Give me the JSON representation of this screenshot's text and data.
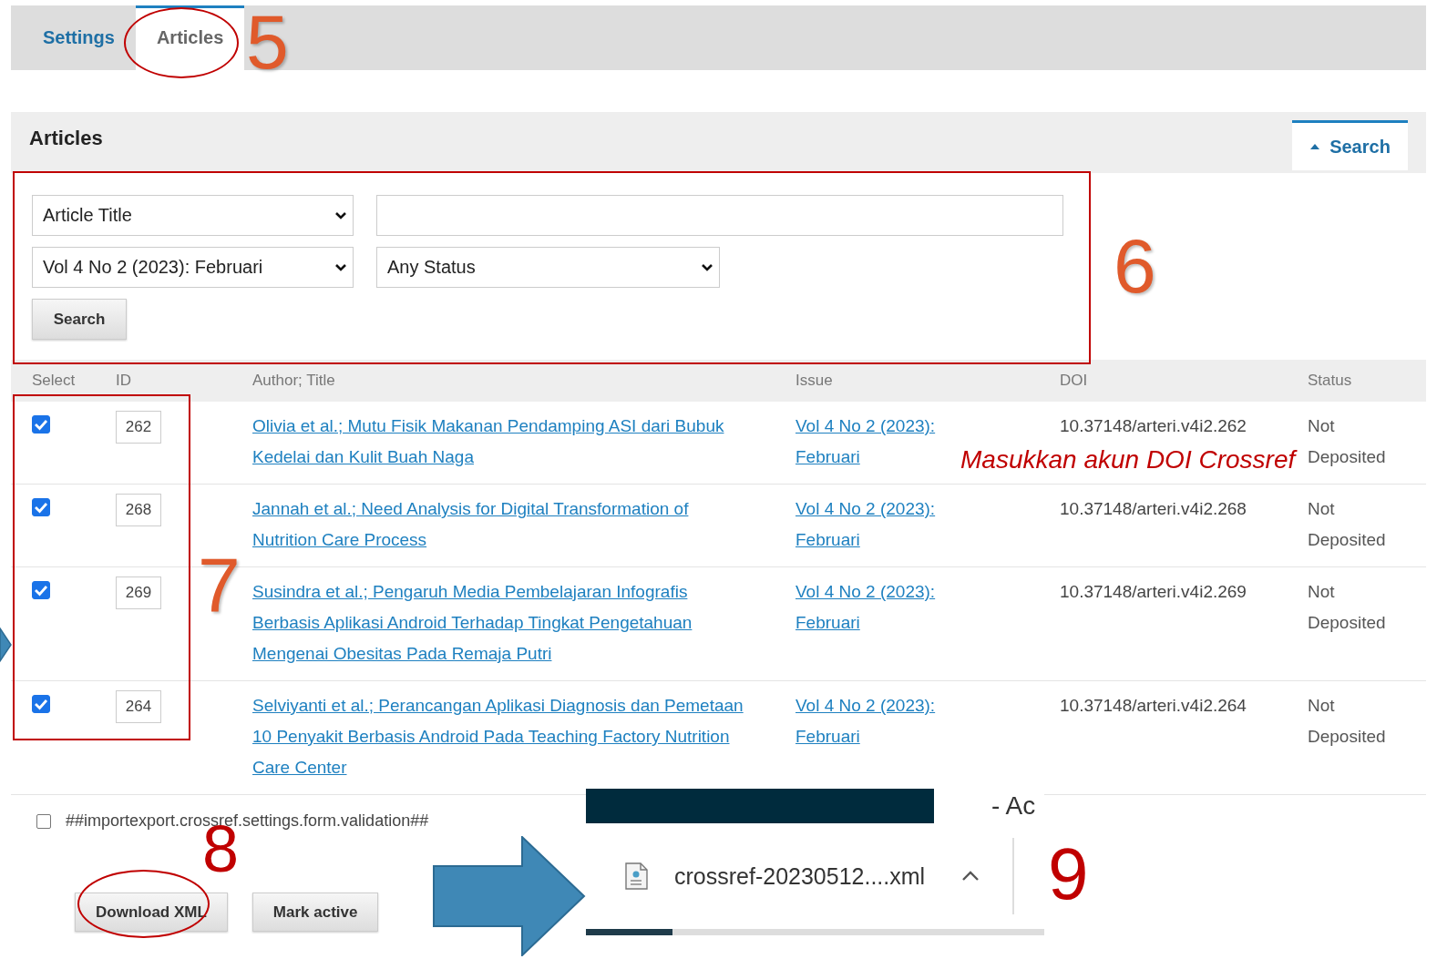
{
  "tabs": [
    {
      "label": "Settings",
      "selected": false
    },
    {
      "label": "Articles",
      "selected": true
    }
  ],
  "panel": {
    "title": "Articles",
    "search_toggle": {
      "label": "Search",
      "expanded": true
    }
  },
  "search_form": {
    "field_select": "Article Title",
    "issue_select": "Vol 4 No 2 (2023): Februari",
    "status_select": "Any Status",
    "button": "Search"
  },
  "table": {
    "columns": [
      "Select",
      "ID",
      "Author; Title",
      "Issue",
      "DOI",
      "Status"
    ],
    "rows": [
      {
        "selected": true,
        "id": "262",
        "title": "Olivia et al.; Mutu Fisik Makanan Pendamping ASI dari Bubuk Kedelai dan Kulit Buah Naga",
        "issue": "Vol 4 No 2 (2023): Februari",
        "doi": "10.37148/arteri.v4i2.262",
        "status": "Not Deposited"
      },
      {
        "selected": true,
        "id": "268",
        "title": "Jannah et al.; Need Analysis for Digital Transformation of Nutrition Care Process",
        "issue": "Vol 4 No 2 (2023): Februari",
        "doi": "10.37148/arteri.v4i2.268",
        "status": "Not Deposited"
      },
      {
        "selected": true,
        "id": "269",
        "title": "Susindra et al.; Pengaruh Media Pembelajaran Infografis Berbasis Aplikasi Android Terhadap Tingkat Pengetahuan Mengenai Obesitas Pada Remaja Putri",
        "issue": "Vol 4 No 2 (2023): Februari",
        "doi": "10.37148/arteri.v4i2.269",
        "status": "Not Deposited"
      },
      {
        "selected": true,
        "id": "264",
        "title": "Selviyanti et al.; Perancangan Aplikasi Diagnosis dan Pemetaan 10 Penyakit Berbasis Android Pada Teaching Factory Nutrition Care Center",
        "issue": "Vol 4 No 2 (2023): Februari",
        "doi": "10.37148/arteri.v4i2.264",
        "status": "Not Deposited"
      }
    ]
  },
  "validation_checkbox": {
    "label": "##importexport.crossref.settings.form.validation##",
    "checked": false
  },
  "buttons": [
    "Download XML",
    "Mark active"
  ],
  "download_bar": {
    "header_text": "- Ac",
    "file_name": "crossref-20230512....xml"
  },
  "annotations": {
    "note": "Masukkan akun DOI Crossref",
    "step_numbers": [
      {
        "label": "5",
        "color": "#e05a2b"
      },
      {
        "label": "6",
        "color": "#e05a2b"
      },
      {
        "label": "7",
        "color": "#e05a2b"
      },
      {
        "label": "8",
        "color": "#c00000"
      },
      {
        "label": "9",
        "color": "#c00000"
      }
    ]
  }
}
